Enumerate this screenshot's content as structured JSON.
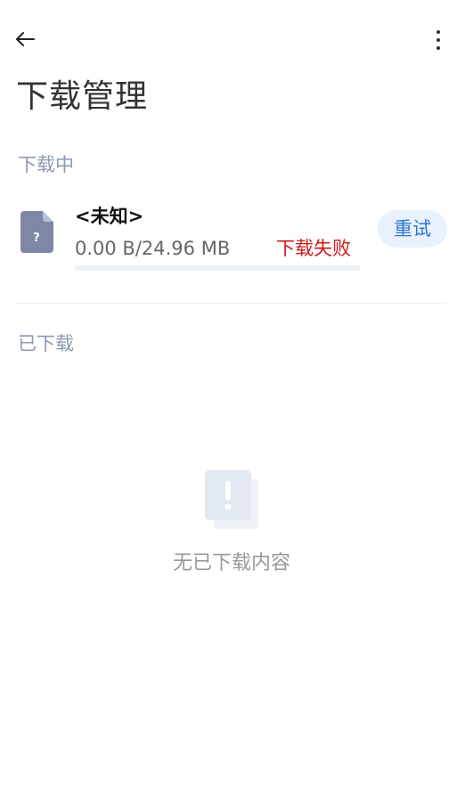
{
  "header": {
    "title": "下载管理",
    "back_icon": "arrow-left-icon",
    "more_icon": "more-vertical-icon"
  },
  "sections": {
    "downloading": "下载中",
    "downloaded": "已下载"
  },
  "downloads": [
    {
      "name": "<未知>",
      "size": "0.00 B/24.96 MB",
      "status": "下载失败",
      "progress": 0,
      "action": "重试",
      "icon": "unknown-file-icon"
    }
  ],
  "empty_state": {
    "text": "无已下载内容",
    "icon": "alert-icon"
  },
  "colors": {
    "accent": "#2f76d2",
    "accent_bg": "#e8f1fd",
    "error": "#cc1a1a",
    "section_label": "#8e97b2"
  }
}
